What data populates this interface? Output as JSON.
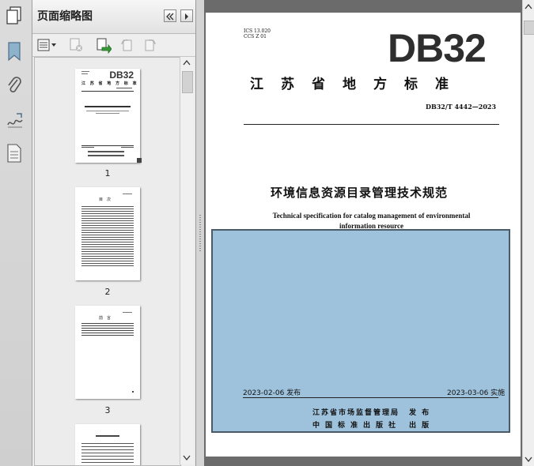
{
  "panel": {
    "title": "页面缩略图",
    "thumbnails": [
      {
        "number": "1"
      },
      {
        "number": "2"
      },
      {
        "number": "3"
      }
    ],
    "thumb1": {
      "db": "DB32",
      "heading": "江 苏 省 地 方 标 准"
    },
    "thumb2": {
      "heading": "目　次"
    },
    "thumb3": {
      "heading": "前　言"
    }
  },
  "icons": {
    "rail": [
      "pages-icon",
      "bookmark-icon",
      "attachment-icon",
      "signature-icon",
      "layers-icon"
    ],
    "toolbar": [
      "thumbnail-options-icon",
      "delete-page-icon",
      "extract-page-icon",
      "rotate-left-icon",
      "rotate-right-icon"
    ]
  },
  "document": {
    "ics": "ICS 13.020",
    "ccs": "CCS Z 01",
    "logo": "DB32",
    "standard_title": "江苏省地方标准",
    "standard_number": "DB32/T 4442—2023",
    "title_cn": "环境信息资源目录管理技术规范",
    "title_en_line1": "Technical specification for catalog management of environmental",
    "title_en_line2": "information resource",
    "publish_date": "2023-02-06 发布",
    "effective_date": "2023-03-06 实施",
    "issuer1": "江苏省市场监督管理局",
    "issuer1_role": "发 布",
    "issuer2": "中国标准出版社",
    "issuer2_role": "出 版"
  },
  "colors": {
    "overlay": "#9ec2dc",
    "overlay_border": "#4a5a68",
    "doc_background": "#6b6b6b"
  }
}
